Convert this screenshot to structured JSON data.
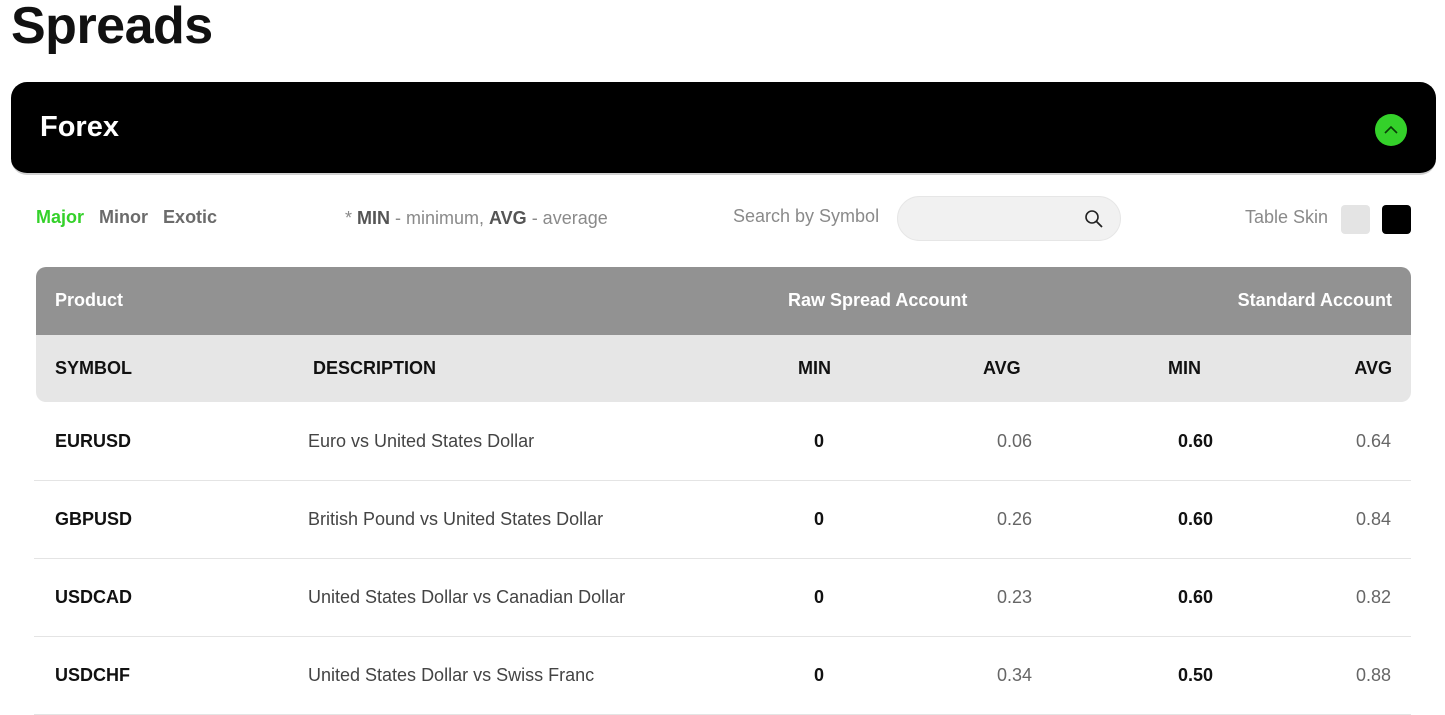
{
  "page": {
    "title": "Spreads"
  },
  "section": {
    "title": "Forex",
    "collapse_icon": "chevron-up-icon",
    "accent": "#34d12a"
  },
  "filters": {
    "tabs": [
      "Major",
      "Minor",
      "Exotic"
    ],
    "active": "Major"
  },
  "legend": {
    "prefix": "* ",
    "min_key": "MIN",
    "min_text": " - minimum, ",
    "avg_key": "AVG",
    "avg_text": " - average"
  },
  "search": {
    "label": "Search by Symbol",
    "placeholder": "",
    "icon": "search-icon"
  },
  "skin": {
    "label": "Table Skin",
    "light_color": "#e4e4e4",
    "dark_color": "#000000"
  },
  "table": {
    "group_headers": {
      "product": "Product",
      "raw": "Raw Spread Account",
      "standard": "Standard Account"
    },
    "columns": {
      "symbol": "SYMBOL",
      "description": "DESCRIPTION",
      "raw_min": "MIN",
      "raw_avg": "AVG",
      "std_min": "MIN",
      "std_avg": "AVG"
    },
    "rows": [
      {
        "symbol": "EURUSD",
        "description": "Euro vs United States Dollar",
        "raw_min": "0",
        "raw_avg": "0.06",
        "std_min": "0.60",
        "std_avg": "0.64"
      },
      {
        "symbol": "GBPUSD",
        "description": "British Pound vs United States Dollar",
        "raw_min": "0",
        "raw_avg": "0.26",
        "std_min": "0.60",
        "std_avg": "0.84"
      },
      {
        "symbol": "USDCAD",
        "description": "United States Dollar vs Canadian Dollar",
        "raw_min": "0",
        "raw_avg": "0.23",
        "std_min": "0.60",
        "std_avg": "0.82"
      },
      {
        "symbol": "USDCHF",
        "description": "United States Dollar vs Swiss Franc",
        "raw_min": "0",
        "raw_avg": "0.34",
        "std_min": "0.50",
        "std_avg": "0.88"
      }
    ]
  }
}
